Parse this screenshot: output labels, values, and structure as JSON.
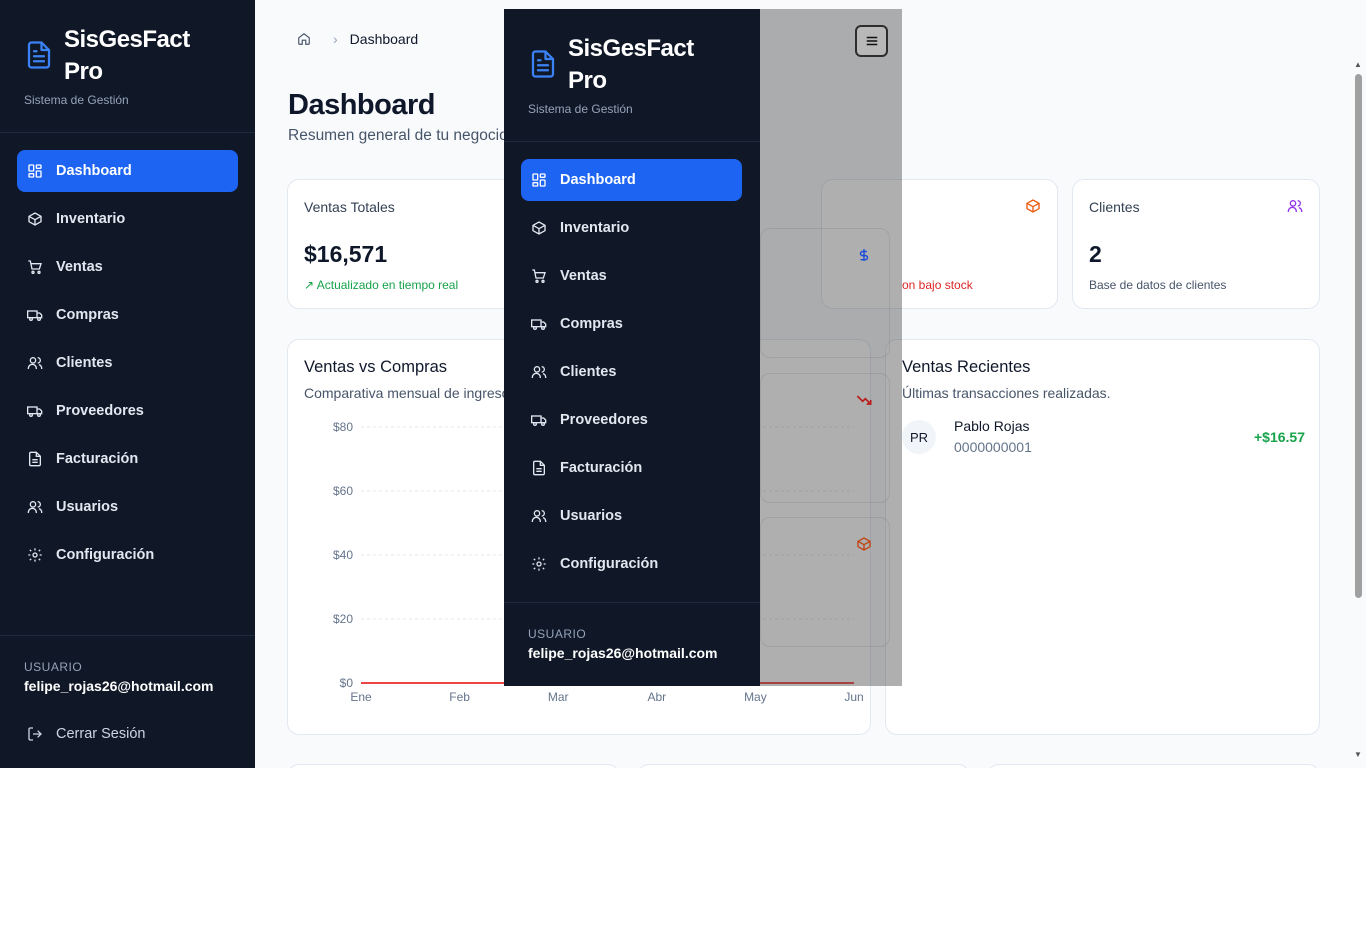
{
  "sidebar": {
    "brand_name": "SisGesFact Pro",
    "brand_sub": "Sistema de Gestión",
    "items": [
      {
        "label": "Dashboard",
        "icon": "dashboard-icon"
      },
      {
        "label": "Inventario",
        "icon": "box-icon"
      },
      {
        "label": "Ventas",
        "icon": "cart-icon"
      },
      {
        "label": "Compras",
        "icon": "truck-icon"
      },
      {
        "label": "Clientes",
        "icon": "users-icon"
      },
      {
        "label": "Proveedores",
        "icon": "truck-icon"
      },
      {
        "label": "Facturación",
        "icon": "file-icon"
      },
      {
        "label": "Usuarios",
        "icon": "users-icon"
      },
      {
        "label": "Configuración",
        "icon": "gear-icon"
      }
    ],
    "user_label": "USUARIO",
    "user_email": "felipe_rojas26@hotmail.com",
    "logout_label": "Cerrar Sesión"
  },
  "header": {
    "breadcrumb_current": "Dashboard",
    "title": "Dashboard",
    "subtitle": "Resumen general de tu negocio"
  },
  "stats": {
    "sales_title": "Ventas Totales",
    "sales_value": "$16,571",
    "sales_foot": "Actualizado en tiempo real",
    "stock_foot": "on bajo stock",
    "clients_title": "Clientes",
    "clients_value": "2",
    "clients_foot": "Base de datos de clientes"
  },
  "chart_card": {
    "title": "Ventas vs Compras",
    "subtitle": "Comparativa mensual de ingresos"
  },
  "chart_data": {
    "type": "line",
    "categories": [
      "Ene",
      "Feb",
      "Mar",
      "Abr",
      "May",
      "Jun"
    ],
    "series": [
      {
        "values": [
          0,
          0,
          0,
          0,
          0,
          0
        ],
        "color": "#ef4444"
      }
    ],
    "yticks": [
      "$0",
      "$20",
      "$40",
      "$60",
      "$80"
    ],
    "ylim": [
      0,
      80
    ],
    "grid": true
  },
  "recent": {
    "title": "Ventas Recientes",
    "subtitle": "Últimas transacciones realizadas.",
    "items": [
      {
        "initials": "PR",
        "name": "Pablo Rojas",
        "doc": "0000000001",
        "amount": "+$16.57"
      }
    ]
  },
  "colors": {
    "sidebar_bg": "#101828",
    "accent": "#1d64f2",
    "positive": "#16a34a",
    "negative": "#dc2626",
    "orange": "#ea580c",
    "purple": "#9333ea"
  }
}
